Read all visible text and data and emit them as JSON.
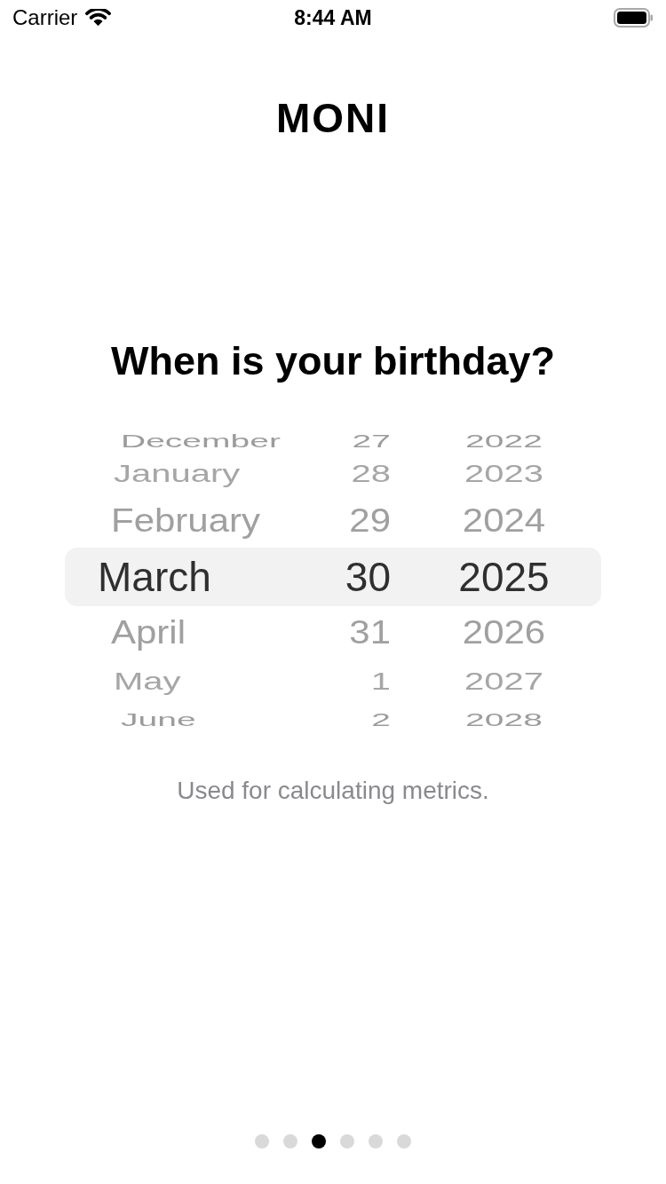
{
  "status_bar": {
    "carrier": "Carrier",
    "time": "8:44 AM"
  },
  "logo": "MONI",
  "title": "When is your birthday?",
  "picker": {
    "rows": [
      {
        "month": "December",
        "day": "27",
        "year": "2022",
        "selected": false
      },
      {
        "month": "January",
        "day": "28",
        "year": "2023",
        "selected": false
      },
      {
        "month": "February",
        "day": "29",
        "year": "2024",
        "selected": false
      },
      {
        "month": "March",
        "day": "30",
        "year": "2025",
        "selected": true
      },
      {
        "month": "April",
        "day": "31",
        "year": "2026",
        "selected": false
      },
      {
        "month": "May",
        "day": "1",
        "year": "2027",
        "selected": false
      },
      {
        "month": "June",
        "day": "2",
        "year": "2028",
        "selected": false
      }
    ]
  },
  "note": "Used for calculating metrics.",
  "page_indicator": [
    {
      "selected": false
    },
    {
      "selected": false
    },
    {
      "selected": true
    },
    {
      "selected": false
    },
    {
      "selected": false
    },
    {
      "selected": false
    }
  ]
}
